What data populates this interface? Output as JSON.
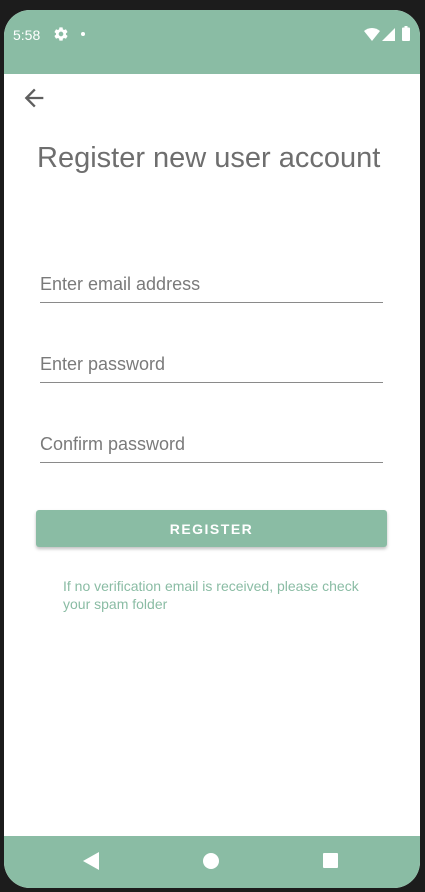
{
  "status_bar": {
    "time": "5:58",
    "icons": [
      "gear-icon",
      "notification-dot-icon",
      "wifi-icon",
      "signal-icon",
      "battery-icon"
    ]
  },
  "toolbar": {
    "back_icon": "arrow-left-icon"
  },
  "page": {
    "title": "Register new user account"
  },
  "form": {
    "email": {
      "placeholder": "Enter email address",
      "value": ""
    },
    "password": {
      "placeholder": "Enter password",
      "value": ""
    },
    "confirm_password": {
      "placeholder": "Confirm password",
      "value": ""
    },
    "register_label": "REGISTER",
    "hint": "If no verification email is received, please check your spam folder"
  },
  "nav_bar": {
    "icons": [
      "nav-back-icon",
      "nav-home-icon",
      "nav-recents-icon"
    ]
  },
  "colors": {
    "accent": "#8abca4",
    "title_text": "#6e6e6e",
    "background": "#ffffff"
  }
}
